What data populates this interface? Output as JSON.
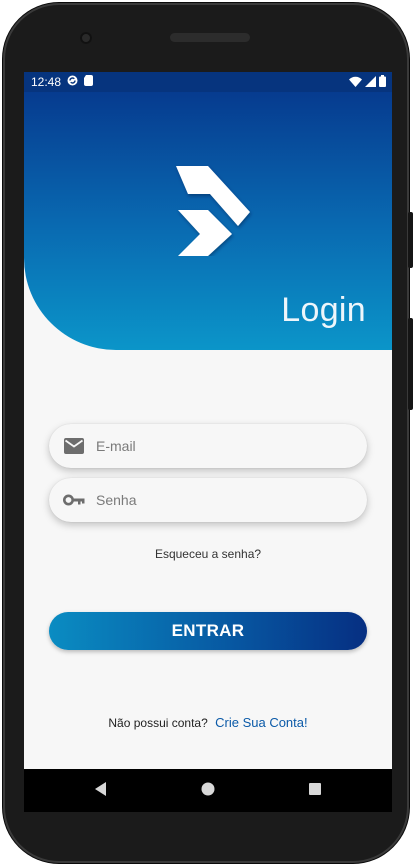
{
  "status_bar": {
    "time": "12:48",
    "left_icons": [
      "sync-icon",
      "sim-card-icon"
    ],
    "right_icons": [
      "wifi-icon",
      "cell-signal-icon",
      "battery-icon"
    ]
  },
  "header": {
    "logo": "chevron-arrows-logo",
    "title": "Login",
    "gradient_colors": [
      "#063b8f",
      "#0b95c9"
    ]
  },
  "form": {
    "email": {
      "icon": "mail-icon",
      "placeholder": "E-mail",
      "value": ""
    },
    "password": {
      "icon": "key-icon",
      "placeholder": "Senha",
      "value": ""
    },
    "forgot_label": "Esqueceu a senha?",
    "submit_label": "ENTRAR"
  },
  "signup": {
    "prompt": "Não possui conta?",
    "link_label": "Crie Sua Conta!"
  },
  "nav_bar": {
    "buttons": [
      "back-icon",
      "home-icon",
      "recents-icon"
    ]
  },
  "colors": {
    "accent_dark": "#062f82",
    "accent_light": "#0a8cc2",
    "link": "#0b5aa8"
  }
}
